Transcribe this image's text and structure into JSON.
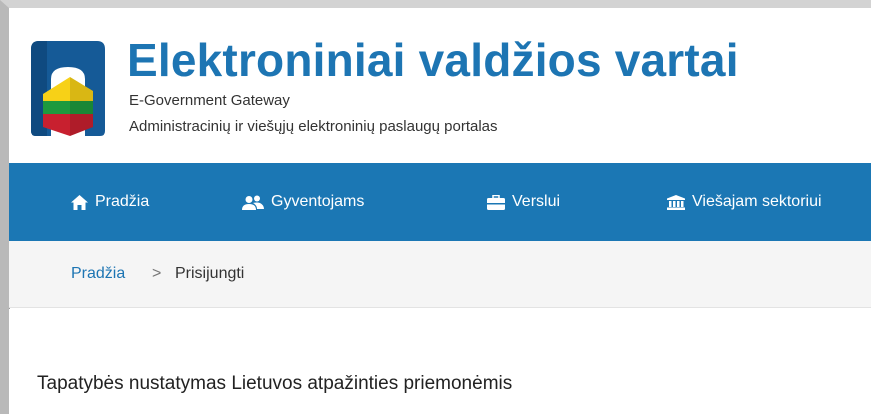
{
  "header": {
    "title": "Elektroniniai valdžios vartai",
    "subtitle_en": "E-Government Gateway",
    "subtitle_lt": "Administracinių ir viešųjų elektroninių paslaugų portalas"
  },
  "nav": {
    "items": [
      {
        "label": "Pradžia",
        "icon": "home-icon"
      },
      {
        "label": "Gyventojams",
        "icon": "users-icon"
      },
      {
        "label": "Verslui",
        "icon": "briefcase-icon"
      },
      {
        "label": "Viešajam sektoriui",
        "icon": "institution-icon"
      }
    ]
  },
  "breadcrumb": {
    "home": "Pradžia",
    "separator": ">",
    "current": "Prisijungti"
  },
  "main": {
    "heading": "Tapatybės nustatymas Lietuvos atpažinties priemonėmis"
  },
  "colors": {
    "brand_blue": "#1b77b4",
    "breadcrumb_bg": "#f5f5f5"
  }
}
